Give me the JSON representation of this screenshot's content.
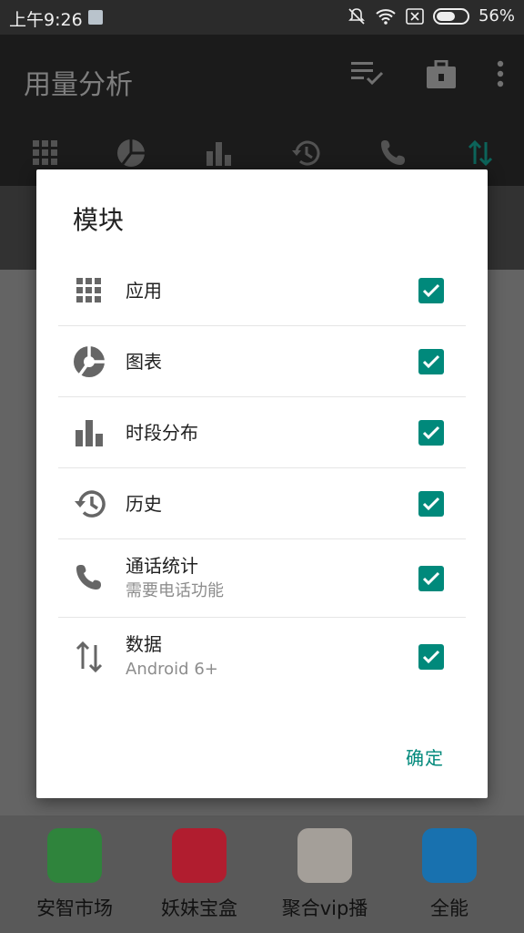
{
  "status_bar": {
    "time": "上午9:26",
    "battery": "56%"
  },
  "app_bar": {
    "title": "用量分析"
  },
  "dialog": {
    "title": "模块",
    "items": [
      {
        "label": "应用",
        "sub": "",
        "checked": true,
        "icon": "grid-icon"
      },
      {
        "label": "图表",
        "sub": "",
        "checked": true,
        "icon": "pie-chart-icon"
      },
      {
        "label": "时段分布",
        "sub": "",
        "checked": true,
        "icon": "bar-chart-icon"
      },
      {
        "label": "历史",
        "sub": "",
        "checked": true,
        "icon": "history-icon"
      },
      {
        "label": "通话统计",
        "sub": "需要电话功能",
        "checked": true,
        "icon": "phone-icon"
      },
      {
        "label": "数据",
        "sub": "Android 6+",
        "checked": true,
        "icon": "data-transfer-icon"
      }
    ],
    "ok_label": "确定"
  },
  "launcher": {
    "apps": [
      {
        "label": "安智市场",
        "color": "#3aa14a"
      },
      {
        "label": "妖妹宝盒",
        "color": "#d8243a"
      },
      {
        "label": "聚合vip播",
        "color": "#c9c2bb"
      },
      {
        "label": "全能",
        "color": "#1e8ad6"
      }
    ]
  },
  "colors": {
    "accent": "#00897b",
    "appbar": "#212121",
    "status": "#2b2b2b"
  }
}
